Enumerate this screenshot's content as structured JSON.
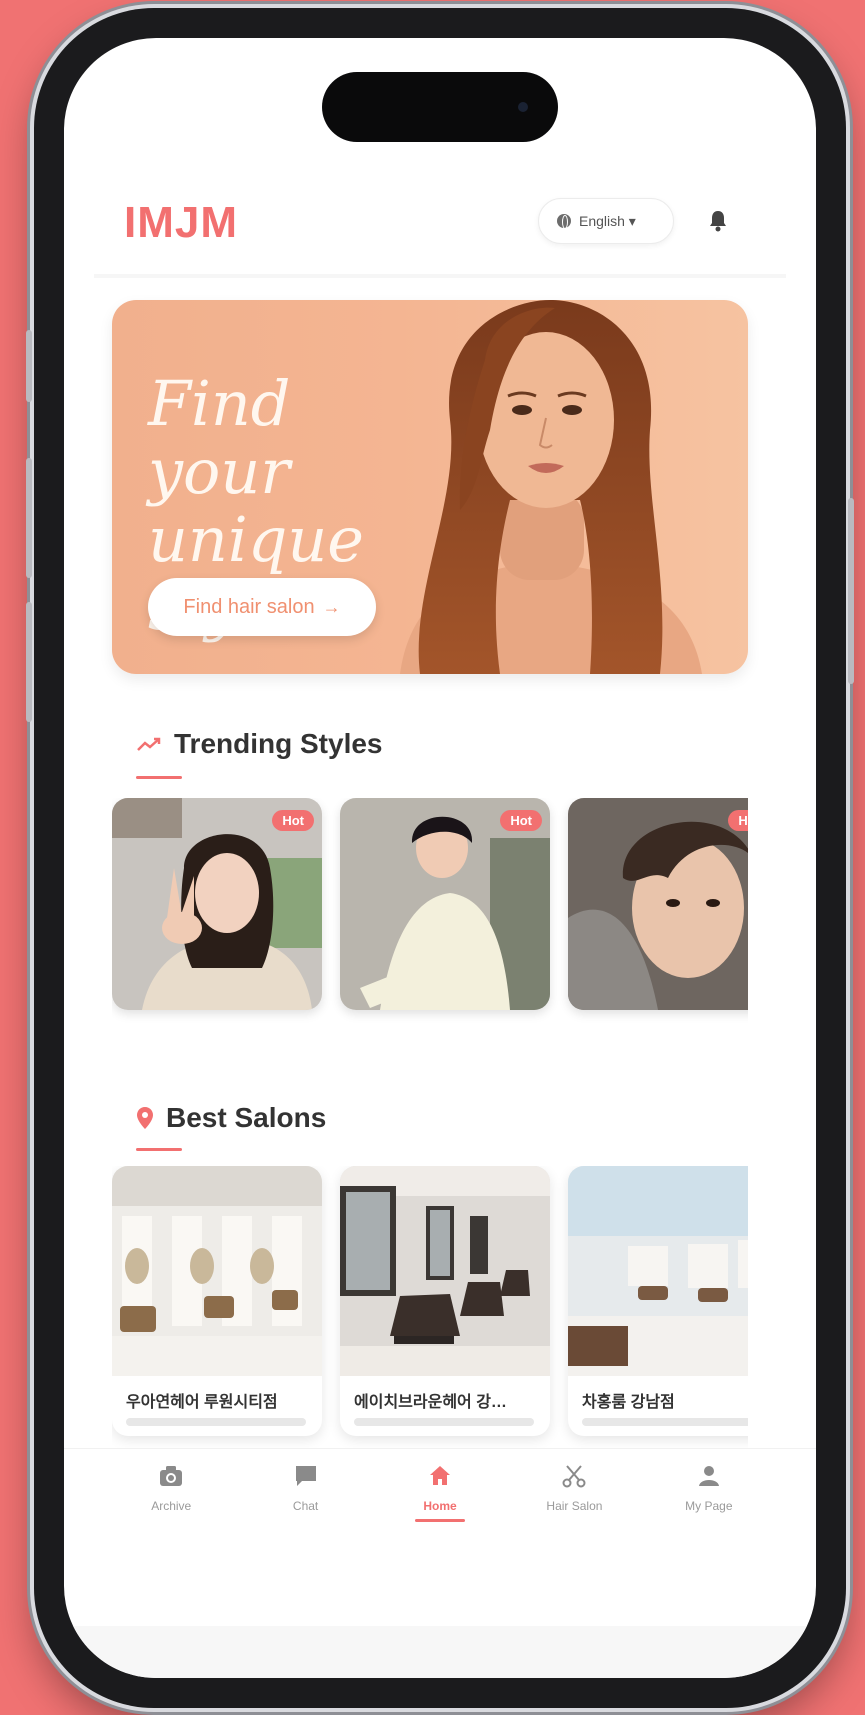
{
  "app": {
    "logo": "IMJM"
  },
  "header": {
    "language": "English ▾"
  },
  "banner": {
    "title_line1": "Find your",
    "title_line2": "unique style",
    "button_label": "Find hair salon",
    "button_arrow": "→"
  },
  "trending": {
    "title": "Trending Styles",
    "badge": "Hot",
    "cards": [
      {
        "badge": "Hot"
      },
      {
        "badge": "Hot"
      },
      {
        "badge": "Hot"
      }
    ]
  },
  "salons": {
    "title": "Best Salons",
    "cards": [
      {
        "name": "우아연헤어 루원시티점"
      },
      {
        "name": "에이치브라운헤어 강…"
      },
      {
        "name": "차홍룸 강남점"
      }
    ]
  },
  "nav": {
    "items": [
      {
        "label": "Archive",
        "icon": "camera-icon"
      },
      {
        "label": "Chat",
        "icon": "chat-icon"
      },
      {
        "label": "Home",
        "icon": "home-icon",
        "active": true
      },
      {
        "label": "Hair Salon",
        "icon": "scissors-icon"
      },
      {
        "label": "My Page",
        "icon": "person-icon"
      }
    ]
  },
  "colors": {
    "accent": "#f27070",
    "background": "#f07272",
    "banner": "#f4b592"
  }
}
